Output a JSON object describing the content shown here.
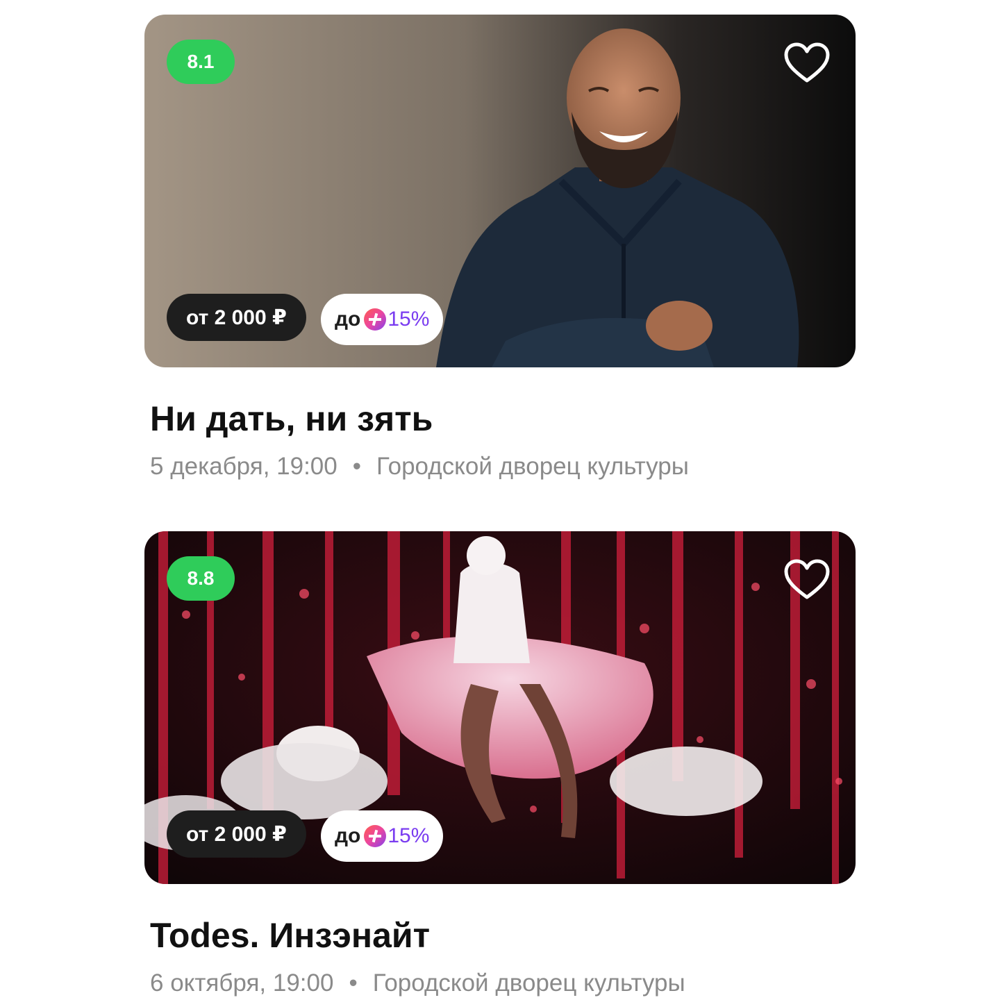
{
  "events": [
    {
      "rating": "8.1",
      "price": "от 2 000 ₽",
      "cashback_prefix": "до",
      "cashback_value": "15%",
      "title": "Ни дать, ни зять",
      "date": "5 декабря, 19:00",
      "separator": "•",
      "venue": "Городской дворец культуры"
    },
    {
      "rating": "8.8",
      "price": "от 2 000 ₽",
      "cashback_prefix": "до",
      "cashback_value": "15%",
      "title": "Todes. Инзэнайт",
      "date": "6 октября, 19:00",
      "separator": "•",
      "venue": "Городской дворец культуры"
    }
  ],
  "colors": {
    "rating_green": "#2fcc5a",
    "price_badge_bg": "#1e1e1e",
    "cashback_purple": "#7a3cf0",
    "meta_gray": "#8a8a8a"
  },
  "icons": [
    "heart-outline-icon",
    "plus-cashback-icon"
  ]
}
